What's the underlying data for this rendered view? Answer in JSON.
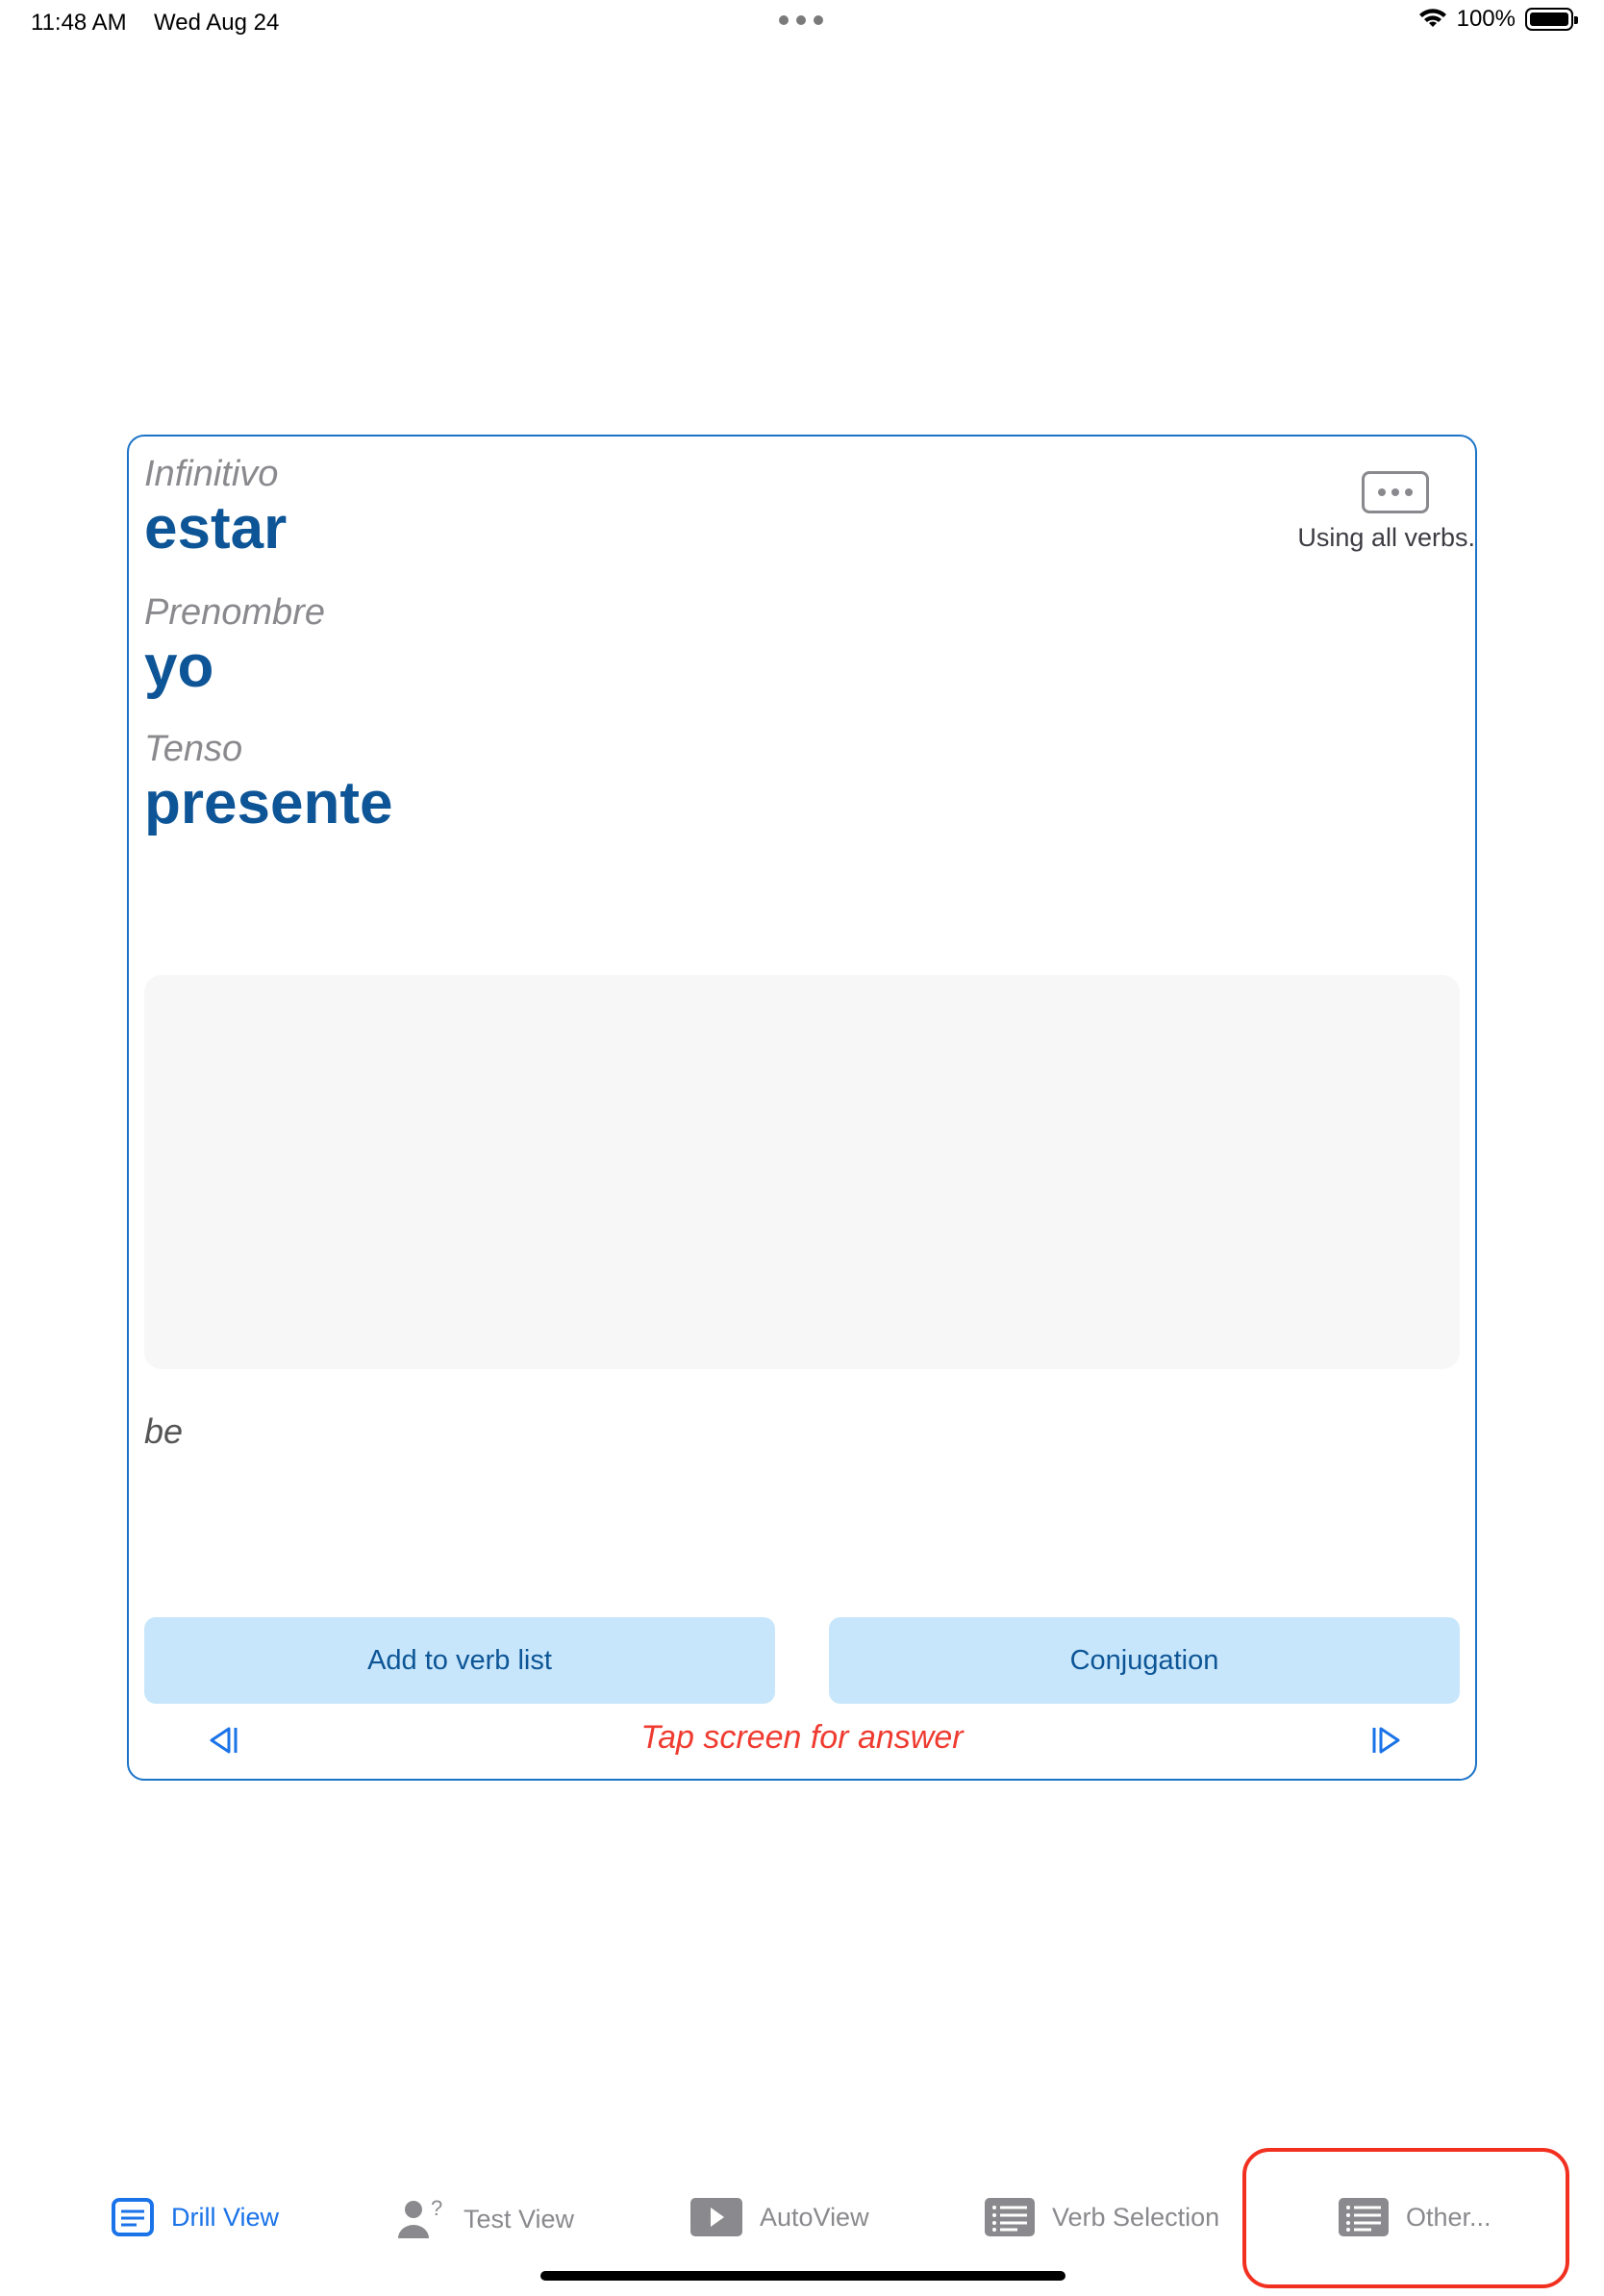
{
  "status_bar": {
    "time": "11:48 AM",
    "date": "Wed Aug 24",
    "battery": "100%"
  },
  "card": {
    "infinitive_label": "Infinitivo",
    "infinitive_value": "estar",
    "pronoun_label": "Prenombre",
    "pronoun_value": "yo",
    "tense_label": "Tenso",
    "tense_value": "presente",
    "verb_scope": "Using all verbs.",
    "translation": "be",
    "add_button": "Add to verb list",
    "conjugation_button": "Conjugation",
    "hint": "Tap screen for answer"
  },
  "tabs": [
    {
      "label": "Drill View",
      "icon": "doc-icon",
      "active": true
    },
    {
      "label": "Test View",
      "icon": "person-question-icon",
      "active": false
    },
    {
      "label": "AutoView",
      "icon": "play-icon",
      "active": false
    },
    {
      "label": "Verb Selection",
      "icon": "list-icon",
      "active": false
    },
    {
      "label": "Other...",
      "icon": "list-icon",
      "active": false
    }
  ],
  "colors": {
    "accent": "#1a73e8",
    "value_text": "#0d5596",
    "button_bg": "#c7e6fb",
    "hint": "#ef3b30",
    "highlight": "#f23020"
  }
}
